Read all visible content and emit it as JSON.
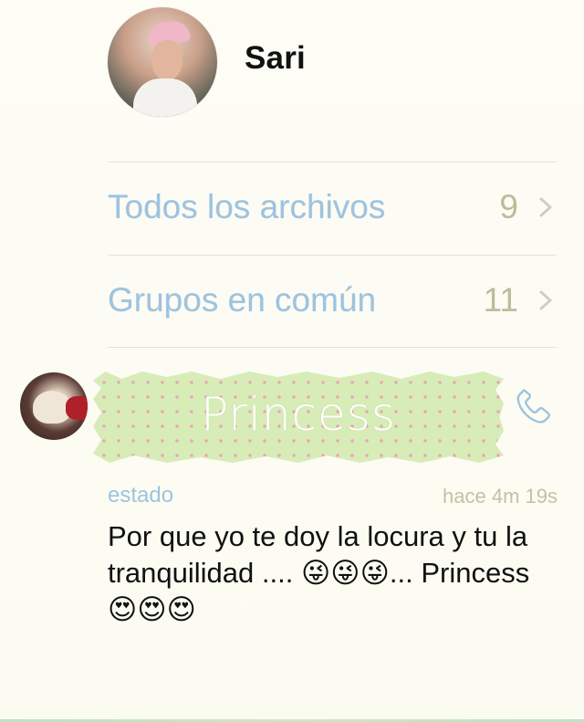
{
  "profile": {
    "name": "Sari"
  },
  "rows": [
    {
      "label": "Todos los archivos",
      "count": "9"
    },
    {
      "label": "Grupos en común",
      "count": "11"
    }
  ],
  "status": {
    "banner_text": "Princess",
    "label": "estado",
    "time": "hace 4m 19s",
    "text": "Por que yo te doy la locura y tu la tranquilidad .... 😜😜😜... Princess 😍😍😍"
  },
  "icons": {
    "chevron": "chevron-right-icon",
    "phone": "phone-icon"
  },
  "colors": {
    "accent_blue": "#9ec3df",
    "count_gray": "#bcbc9c",
    "tape_green": "#d8ecb8",
    "tape_dots": "#e9a7b4"
  }
}
